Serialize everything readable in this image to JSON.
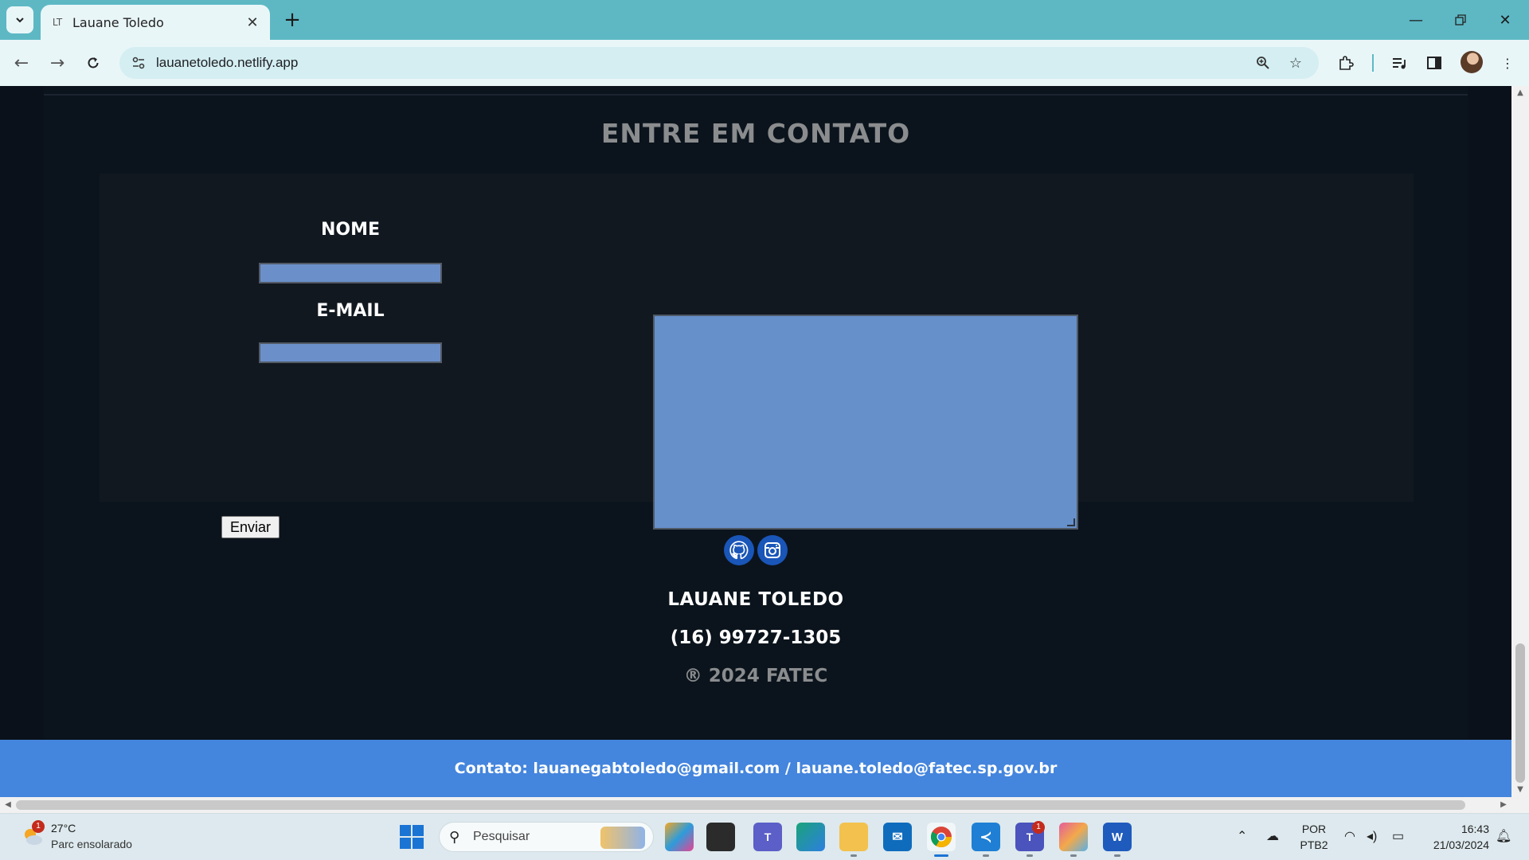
{
  "browser": {
    "tab_title": "Lauane Toledo",
    "tab_favicon": "LT",
    "url": "lauanetoledo.netlify.app",
    "new_tab_label": "+"
  },
  "contact_section": {
    "title": "ENTRE EM CONTATO",
    "name_label": "NOME",
    "name_value": "",
    "email_label": "E-MAIL",
    "email_value": "",
    "message_value": "",
    "submit_label": "Enviar"
  },
  "footer": {
    "social_icons": [
      "github-icon",
      "instagram-icon"
    ],
    "name": "LAUANE TOLEDO",
    "phone": "(16) 99727-1305",
    "copyright": "® 2024 FATEC",
    "contact_bar": "Contato: lauanegabtoledo@gmail.com / lauane.toledo@fatec.sp.gov.br"
  },
  "taskbar": {
    "weather_temp": "27°C",
    "weather_desc": "Parc ensolarado",
    "weather_badge": "1",
    "search_placeholder": "Pesquisar",
    "teams_badge": "1",
    "lang_line1": "POR",
    "lang_line2": "PTB2",
    "time": "16:43",
    "date": "21/03/2024"
  },
  "colors": {
    "page_bg": "#0b111a",
    "form_bg": "#111820",
    "field_bg": "#6b90c9",
    "contact_bar_bg": "#4485dd",
    "social_bg": "#1a55b8",
    "chrome_accent": "#5db8c4"
  }
}
